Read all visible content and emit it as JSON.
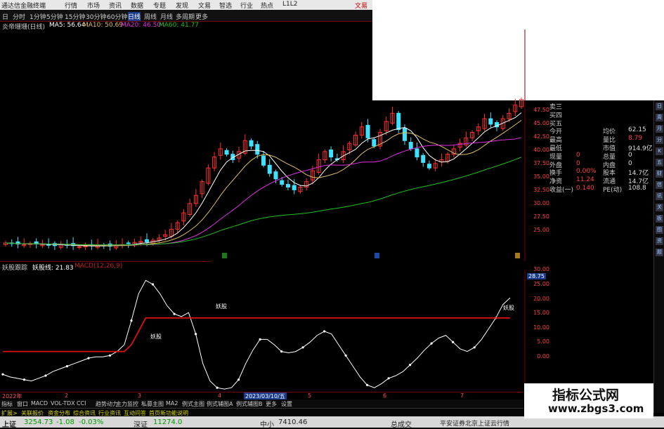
{
  "titlebar": {
    "app_title": "通达信金融终端",
    "menus": [
      "行情",
      "市场",
      "资讯",
      "数据",
      "专题",
      "发现",
      "文易",
      "智选",
      "行业",
      "热点",
      "L1L2"
    ],
    "right": "文易"
  },
  "periodbar": {
    "items": [
      "日",
      "分时",
      "1分钟",
      "5分钟",
      "15分钟",
      "30分钟",
      "60分钟",
      "日线",
      "周线",
      "月线",
      "多周期",
      "更多"
    ]
  },
  "ma_info": {
    "name": "炎帝珊珊(日线)",
    "ma5": "MA5: 56.64",
    "ma10": "MA10: 50.69",
    "ma20": "MA20: 46.50",
    "ma60": "MA60: 41.77"
  },
  "quote": {
    "rows": [
      [
        "卖三",
        "",
        "",
        ""
      ],
      [
        "买四",
        "",
        "",
        ""
      ],
      [
        "买五",
        "",
        "",
        ""
      ],
      [
        "今开",
        "",
        "均价",
        "62.15"
      ],
      [
        "最高",
        "",
        "量比",
        "8.79"
      ],
      [
        "最低",
        "",
        "市值",
        "914.9亿"
      ],
      [
        "现量",
        "0",
        "总量",
        "0"
      ],
      [
        "外盘",
        "0",
        "内盘",
        "0"
      ],
      [
        "换手",
        "0.00%",
        "股本",
        "14.7亿"
      ],
      [
        "净资",
        "11.24",
        "流通",
        "14.7亿"
      ],
      [
        "收益(一)",
        "0.140",
        "PE(动)",
        "108.8"
      ]
    ]
  },
  "axis_top": [
    "47.50",
    "45.00",
    "42.50",
    "40.00",
    "37.50",
    "35.00",
    "32.50",
    "30.00",
    "27.50",
    "25.00"
  ],
  "indicator": {
    "name": "妖股跟踪",
    "line_label": "妖股线: 21.83",
    "macd": "MACD(12,26,9)",
    "value_tag": "28.75"
  },
  "axis_bot": [
    "30.00",
    "25.00",
    "20.00",
    "15.00",
    "10.00",
    "5.00",
    "0.00"
  ],
  "markers": {
    "yao_label": "妖股"
  },
  "datebar": {
    "items": [
      "2022年",
      "2",
      "3",
      "4",
      "5",
      "6",
      "7"
    ],
    "highlight": "2023/03/10/五"
  },
  "tabs": [
    "指标",
    "窗口",
    "MACD",
    "VOL-TDX",
    "CCI",
    "趋势动力",
    "主力监控",
    "私募主图",
    "MA2",
    "例式主图",
    "例式辅图A",
    "例式辅图B",
    "更多",
    "设置"
  ],
  "tabs2": [
    "扩展>",
    "关联报价",
    "资金分布",
    "综合资讯",
    "行业资讯",
    "互动问答",
    "首页新功能说明"
  ],
  "statusbar": {
    "sh_name": "上证",
    "sh_val": "3254.73",
    "sh_chg": "-1.08",
    "sh_pct": "-0.03%",
    "sz_name": "深证",
    "sz_val": "11274.0",
    "zx_name": "中小",
    "zx_val": "7410.46",
    "zcj": "总成交",
    "broker": "平安证券北京上证云行情"
  },
  "watermark": {
    "line1": "指标公式网",
    "line2": "www.zbgs3.com"
  },
  "right_tools": [
    "日",
    "周",
    "月",
    "分",
    "K",
    "五",
    "财",
    "信",
    "讯",
    "关",
    "板",
    "图",
    "资",
    "题"
  ],
  "chart_data": [
    {
      "type": "candlestick",
      "title": "",
      "y_axis_ticks": [
        25.0,
        27.5,
        30.0,
        32.5,
        35.0,
        37.5,
        40.0,
        42.5,
        45.0,
        47.5
      ],
      "ylim": [
        20.5,
        49.5
      ],
      "series": [
        {
          "name": "MA5",
          "color": "#ffffff"
        },
        {
          "name": "MA10",
          "color": "#e0c060"
        },
        {
          "name": "MA20",
          "color": "#e030e0"
        },
        {
          "name": "MA60",
          "color": "#20c020"
        }
      ],
      "closes": [
        22.3,
        22.2,
        22.1,
        22.0,
        22.2,
        22.1,
        22.0,
        21.9,
        21.8,
        22.0,
        21.9,
        21.8,
        21.6,
        21.7,
        21.8,
        21.9,
        21.8,
        21.7,
        21.9,
        22.0,
        22.2,
        22.4,
        22.6,
        22.5,
        22.8,
        23.2,
        23.8,
        24.8,
        26.0,
        27.8,
        29.5,
        31.0,
        33.5,
        36.0,
        38.0,
        39.5,
        38.5,
        37.5,
        39.0,
        41.0,
        40.0,
        38.5,
        36.5,
        35.0,
        34.0,
        33.0,
        32.5,
        32.0,
        32.5,
        33.5,
        35.5,
        37.5,
        39.0,
        38.0,
        37.5,
        39.0,
        40.5,
        42.0,
        43.5,
        41.5,
        40.0,
        42.5,
        44.5,
        46.0,
        43.0,
        41.0,
        39.5,
        38.0,
        37.0,
        36.0,
        36.8,
        37.5,
        38.5,
        39.5,
        40.5,
        41.5,
        42.5,
        43.5,
        45.0,
        44.0,
        43.5,
        45.0,
        46.0,
        47.5,
        48.5
      ]
    },
    {
      "type": "line",
      "title": "",
      "y_axis_ticks": [
        0,
        5,
        10,
        15,
        20,
        25,
        30
      ],
      "ylim": [
        -12,
        33
      ],
      "series": [
        {
          "name": "妖股线",
          "color": "#ffffff",
          "values": [
            -6.0,
            -7.0,
            -7.5,
            -8.0,
            -8.5,
            -7.5,
            -6.5,
            -5.0,
            -4.0,
            -3.0,
            -2.0,
            -1.0,
            0.0,
            0.5,
            0.5,
            1.0,
            2.5,
            5.0,
            14.0,
            24.0,
            29.0,
            27.5,
            24.0,
            19.5,
            16.5,
            15.5,
            17.0,
            9.0,
            -2.0,
            -8.5,
            -11.0,
            -11.5,
            -11.0,
            -8.0,
            -2.0,
            3.0,
            7.0,
            7.0,
            5.0,
            2.5,
            2.0,
            2.5,
            4.0,
            6.0,
            8.5,
            10.0,
            9.0,
            5.0,
            1.0,
            -3.0,
            -7.0,
            -10.0,
            -11.0,
            -9.5,
            -7.5,
            -6.5,
            -5.0,
            -2.5,
            0.0,
            3.0,
            5.5,
            7.5,
            8.5,
            6.0,
            3.5,
            2.5,
            4.0,
            7.0,
            11.0,
            15.0,
            20.0,
            22.5
          ]
        },
        {
          "name": "",
          "color": "#dd1111",
          "values": [
            2.5,
            2.5,
            2.5,
            2.5,
            2.5,
            2.5,
            2.5,
            2.5,
            2.5,
            2.5,
            2.5,
            2.5,
            2.5,
            2.5,
            2.5,
            2.5,
            2.5,
            2.5,
            5.0,
            10.0,
            15.0,
            15.0,
            15.0,
            15.0,
            15.0,
            15.0,
            15.0,
            15.0,
            15.0,
            15.0,
            15.0,
            15.0,
            15.0,
            15.0,
            15.0,
            15.0,
            15.0,
            15.0,
            15.0,
            15.0,
            15.0,
            15.0,
            15.0,
            15.0,
            15.0,
            15.0,
            15.0,
            15.0,
            15.0,
            15.0,
            15.0,
            15.0,
            15.0,
            15.0,
            15.0,
            15.0,
            15.0,
            15.0,
            15.0,
            15.0,
            15.0,
            15.0,
            15.0,
            15.0,
            15.0,
            15.0,
            15.0,
            15.0,
            15.0,
            15.0,
            15.0,
            15.0
          ]
        }
      ]
    }
  ]
}
